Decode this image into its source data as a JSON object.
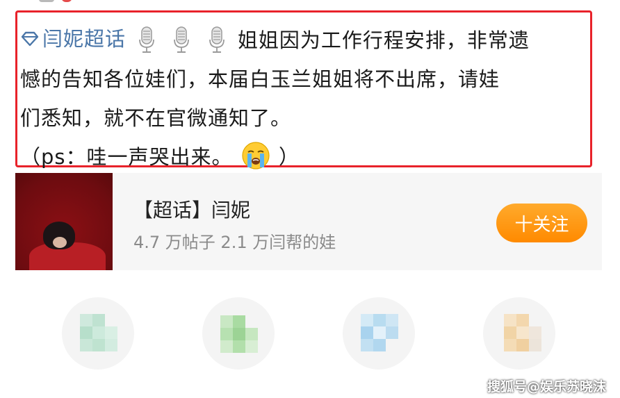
{
  "post": {
    "topic_tag": "闫妮超话",
    "line1_text": "姐姐因为工作行程安排，非常遗",
    "line2_text": "憾的告知各位娃们，本届白玉兰姐姐将不出席，请娃",
    "line3_text": "们悉知，就不在官微通知了。",
    "line4_prefix": "（ps：哇一声哭出来。",
    "line4_suffix": "）",
    "emojis": [
      "microphone-icon",
      "microphone-icon",
      "microphone-icon",
      "crying-face-icon"
    ]
  },
  "topic_card": {
    "title": "【超话】闫妮",
    "stats": "4.7 万帖子  2.1 万闫帮的娃",
    "follow_label": "十关注"
  },
  "watermark": "搜狐号@娱乐苏晓沫",
  "colors": {
    "highlight_border": "#e8222a",
    "link_blue": "#4a76a8",
    "follow_orange": "#ff9a1a"
  }
}
